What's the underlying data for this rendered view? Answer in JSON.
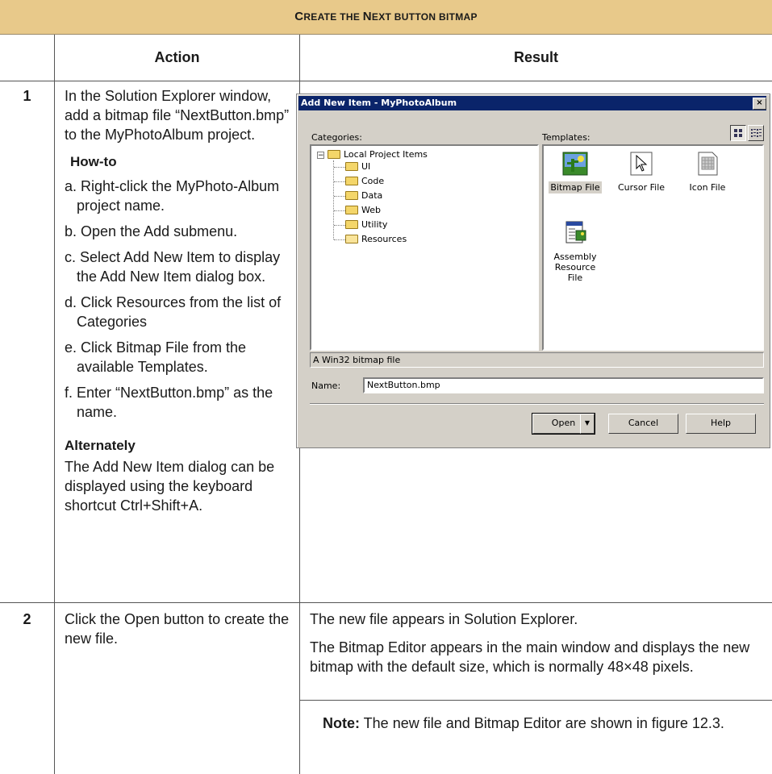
{
  "table": {
    "title": "Create the Next button bitmap",
    "title_parts": {
      "c1": "C",
      "r1": "REATE THE ",
      "c2": "N",
      "r2": "EXT BUTTON BITMAP"
    },
    "col_action": "Action",
    "col_result": "Result"
  },
  "step1": {
    "number": "1",
    "action": "In the Solution Explorer window, add a bitmap file “NextButton.bmp” to the MyPhotoAlbum project.",
    "howto_title": "How-to",
    "howto_items": [
      "a. Right-click the MyPhoto-Album project name.",
      "b. Open the Add submenu.",
      "c. Select Add New Item to display the Add New Item dialog box.",
      "d. Click Resources from the list of Categories",
      "e. Click Bitmap File from the available Templates.",
      "f. Enter “NextButton.bmp” as the name."
    ],
    "alt_title": "Alternately",
    "alt_text": "The Add New Item dialog can be displayed using the keyboard shortcut Ctrl+Shift+A."
  },
  "dialog": {
    "title": "Add New Item - MyPhotoAlbum",
    "close": "×",
    "categories_label": "Categories:",
    "templates_label": "Templates:",
    "tree": {
      "root": "Local Project Items",
      "children": [
        "UI",
        "Code",
        "Data",
        "Web",
        "Utility",
        "Resources"
      ]
    },
    "templates": [
      "Bitmap File",
      "Cursor File",
      "Icon File",
      "Assembly Resource File"
    ],
    "description": "A Win32 bitmap file",
    "name_label": "Name:",
    "name_value": "NextButton.bmp",
    "buttons": {
      "open": "Open",
      "cancel": "Cancel",
      "help": "Help"
    }
  },
  "step2": {
    "number": "2",
    "action": "Click the Open button to create the new file.",
    "result1": "The new file appears in Solution Explorer.",
    "result2": "The Bitmap Editor appears in the main window and displays the new bitmap with the default size, which is normally 48×48 pixels.",
    "note_label": "Note:",
    "note_text": " The new file and Bitmap Editor are shown in figure 12.3."
  }
}
